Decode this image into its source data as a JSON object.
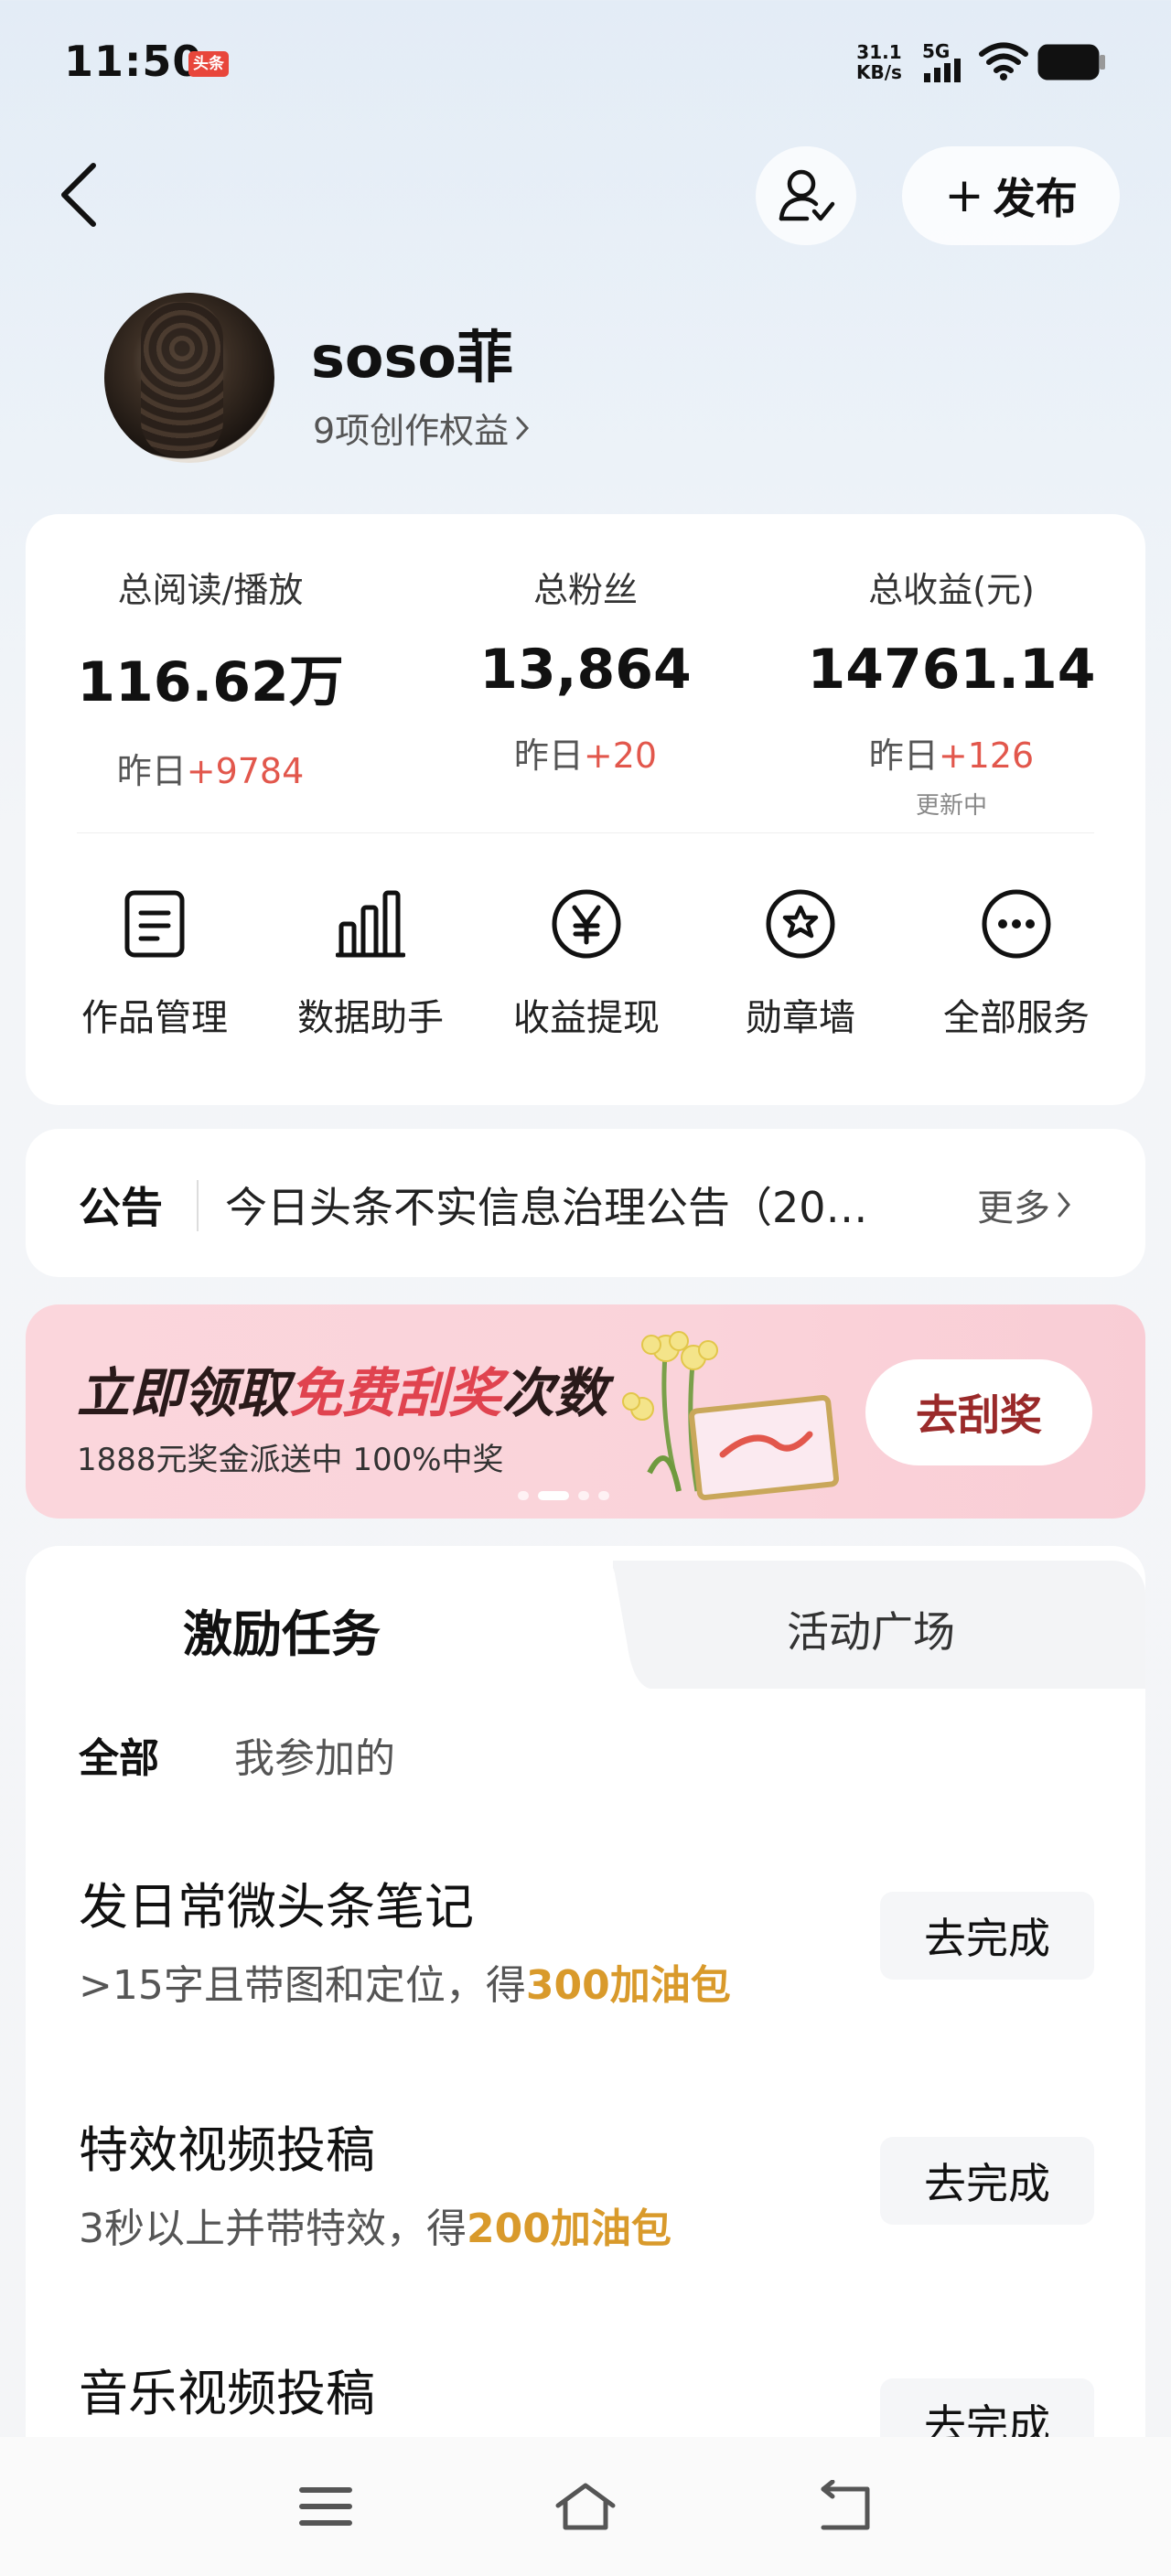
{
  "status_bar": {
    "time": "11:50",
    "app_badge": "头条",
    "net_speed_value": "31.1",
    "net_speed_unit": "KB/s",
    "network": "5G"
  },
  "header": {
    "publish_label": "发布"
  },
  "profile": {
    "username": "soso菲",
    "rights": "9项创作权益"
  },
  "stats": [
    {
      "label": "总阅读/播放",
      "value": "116.62万",
      "delta_prefix": "昨日",
      "delta": "+9784",
      "note": ""
    },
    {
      "label": "总粉丝",
      "value": "13,864",
      "delta_prefix": "昨日",
      "delta": "+20",
      "note": ""
    },
    {
      "label": "总收益(元)",
      "value": "14761.14",
      "delta_prefix": "昨日",
      "delta": "+126",
      "note": "更新中"
    }
  ],
  "tools": [
    {
      "label": "作品管理",
      "icon": "document-icon"
    },
    {
      "label": "数据助手",
      "icon": "bar-chart-icon"
    },
    {
      "label": "收益提现",
      "icon": "yuan-icon"
    },
    {
      "label": "勋章墙",
      "icon": "badge-icon"
    },
    {
      "label": "全部服务",
      "icon": "more-icon"
    }
  ],
  "notice": {
    "title": "公告",
    "text": "今日头条不实信息治理公告（20…",
    "more": "更多"
  },
  "banner": {
    "title_pre": "立即领取",
    "title_highlight": "免费刮奖",
    "title_post": "次数",
    "subtitle": "1888元奖金派送中 100%中奖",
    "button": "去刮奖"
  },
  "tabs": {
    "active": "激励任务",
    "inactive": "活动广场"
  },
  "filters": {
    "all": "全部",
    "mine": "我参加的"
  },
  "tasks": [
    {
      "title": "发日常微头条笔记",
      "desc": ">15字且带图和定位，得",
      "reward": "300加油包",
      "button": "去完成"
    },
    {
      "title": "特效视频投稿",
      "desc": "3秒以上并带特效，得",
      "reward": "200加油包",
      "button": "去完成"
    },
    {
      "title": "音乐视频投稿",
      "desc": "",
      "reward": "",
      "button": "去完成"
    }
  ],
  "colors": {
    "accent_red": "#e2574c",
    "reward_gold": "#d99a2b",
    "banner_pink": "#fbd6dc"
  }
}
